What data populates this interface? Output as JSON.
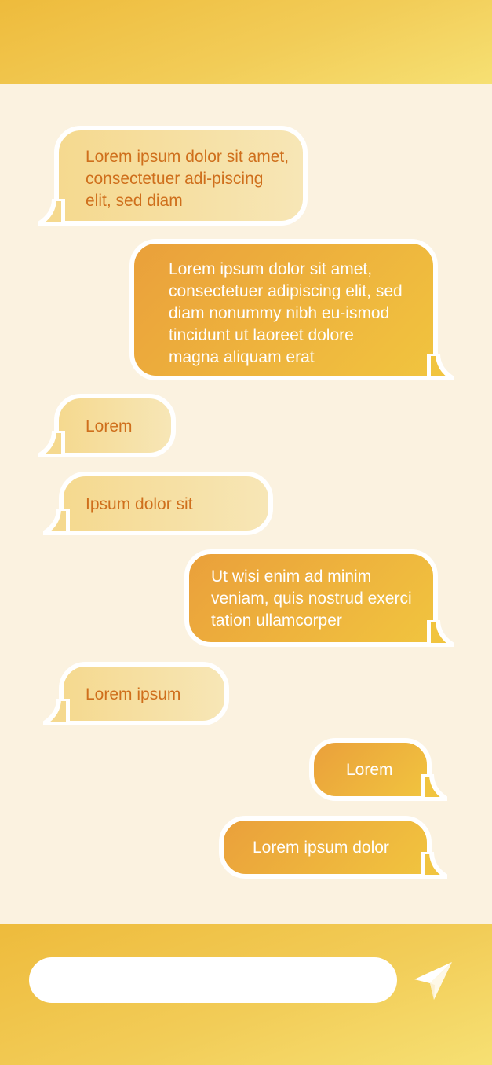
{
  "colors": {
    "header_gradient": [
      "#eebb3c",
      "#f6e073"
    ],
    "background": "#fbf2e0",
    "incoming_bubble": "#f6dc98",
    "incoming_text": "#cf6f1c",
    "outgoing_bubble": "#eeb23c",
    "outgoing_text": "#ffffff"
  },
  "messages": [
    {
      "direction": "incoming",
      "text": "Lorem ipsum dolor sit amet, consectetuer adi-piscing elit, sed diam"
    },
    {
      "direction": "outgoing",
      "text": "Lorem ipsum dolor sit amet, consectetuer adipiscing elit, sed diam nonummy nibh eu-ismod tincidunt ut laoreet dolore magna aliquam erat"
    },
    {
      "direction": "incoming",
      "text": "Lorem"
    },
    {
      "direction": "incoming",
      "text": "Ipsum dolor sit"
    },
    {
      "direction": "outgoing",
      "text": "Ut wisi enim ad minim veniam, quis nostrud exerci tation ullamcorper"
    },
    {
      "direction": "incoming",
      "text": "Lorem ipsum"
    },
    {
      "direction": "outgoing",
      "text": "Lorem"
    },
    {
      "direction": "outgoing",
      "text": "Lorem ipsum dolor"
    }
  ],
  "composer": {
    "input_value": "",
    "send_icon": "paper-plane-icon"
  }
}
